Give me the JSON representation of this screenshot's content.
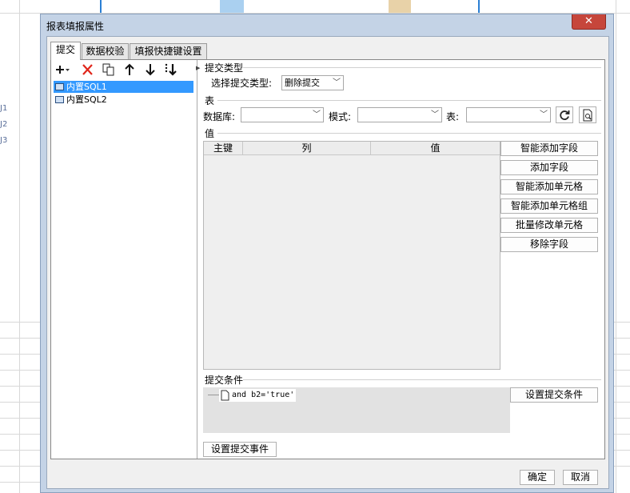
{
  "background": {
    "row_labels": [
      "J1",
      "J2",
      "J3"
    ]
  },
  "dialog": {
    "title": "报表填报属性",
    "close_glyph": "✕",
    "tabs": [
      {
        "label": "提交",
        "active": true
      },
      {
        "label": "数据校验",
        "active": false
      },
      {
        "label": "填报快捷键设置",
        "active": false
      }
    ],
    "toolbar_icons": [
      "add-icon",
      "delete-icon",
      "copy-icon",
      "move-up-icon",
      "move-down-icon",
      "move-bottom-icon"
    ],
    "submit_list": [
      {
        "label": "内置SQL1",
        "selected": true
      },
      {
        "label": "内置SQL2",
        "selected": false
      }
    ],
    "submit_type": {
      "section_label": "提交类型",
      "field_label": "选择提交类型:",
      "value": "删除提交"
    },
    "table_section": {
      "section_label": "表",
      "database_label": "数据库:",
      "schema_label": "模式:",
      "table_label": "表:",
      "database_value": "",
      "schema_value": "",
      "table_value": ""
    },
    "value_section": {
      "section_label": "值",
      "columns": [
        "主键",
        "列",
        "值"
      ],
      "rows": []
    },
    "value_buttons": [
      "智能添加字段",
      "添加字段",
      "智能添加单元格",
      "智能添加单元格组",
      "批量修改单元格",
      "移除字段"
    ],
    "condition": {
      "section_label": "提交条件",
      "item": "and b2='true'",
      "button": "设置提交条件"
    },
    "event_button": "设置提交事件",
    "ok_button": "确定",
    "cancel_button": "取消"
  }
}
